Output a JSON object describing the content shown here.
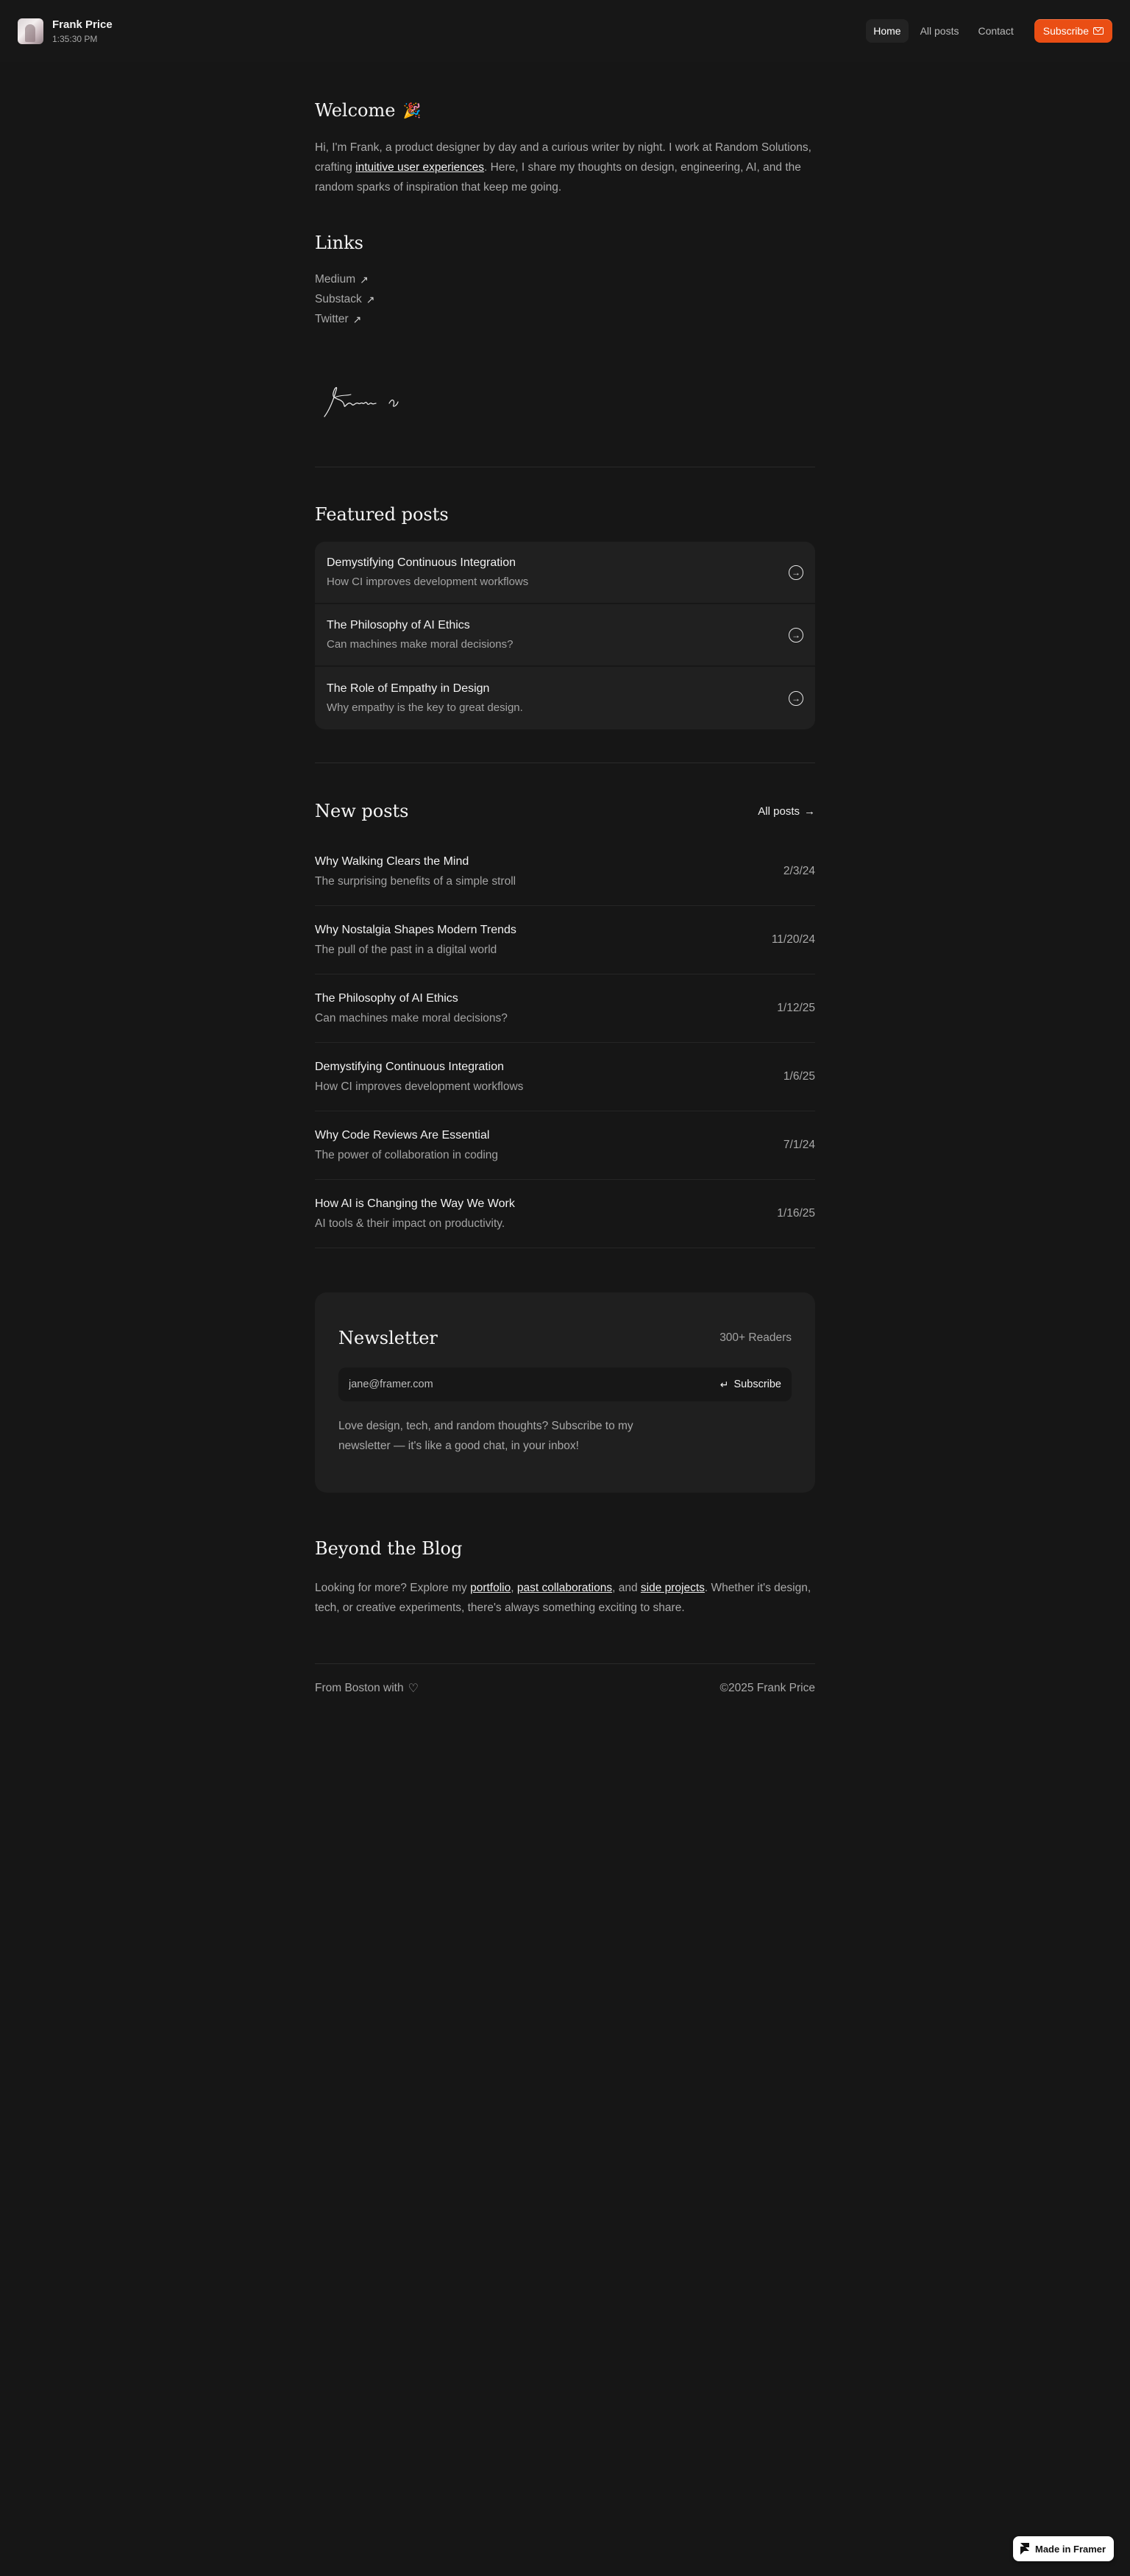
{
  "header": {
    "name": "Frank Price",
    "time": "1:35:30 PM",
    "nav": [
      {
        "label": "Home"
      },
      {
        "label": "All posts"
      },
      {
        "label": "Contact"
      }
    ],
    "subscribe_label": "Subscribe",
    "colors": {
      "accent": "#ea4e14"
    }
  },
  "welcome": {
    "title": "Welcome",
    "title_icon": "party-popper-icon",
    "text_before": "Hi, I'm Frank, a product designer by day and a curious writer by night. I work at Random Solutions, crafting ",
    "link": "intuitive user experiences",
    "text_after": ". Here, I share my thoughts on design, engineering, AI, and the random sparks of inspiration that keep me going."
  },
  "links": {
    "title": "Links",
    "items": [
      {
        "label": "Medium"
      },
      {
        "label": "Substack"
      },
      {
        "label": "Twitter"
      }
    ]
  },
  "featured": {
    "title": "Featured posts",
    "items": [
      {
        "title": "Demystifying Continuous Integration",
        "subtitle": "How CI improves development workflows"
      },
      {
        "title": "The Philosophy of AI Ethics",
        "subtitle": "Can machines make moral decisions?"
      },
      {
        "title": "The Role of Empathy in Design",
        "subtitle": "Why empathy is the key to great design."
      }
    ]
  },
  "new_posts": {
    "title": "New posts",
    "all_posts_label": "All posts",
    "items": [
      {
        "title": "Why Walking Clears the Mind",
        "subtitle": "The surprising benefits of a simple stroll",
        "date": "2/3/24"
      },
      {
        "title": "Why Nostalgia Shapes Modern Trends",
        "subtitle": "The pull of the past in a digital world",
        "date": "11/20/24"
      },
      {
        "title": "The Philosophy of AI Ethics",
        "subtitle": "Can machines make moral decisions?",
        "date": "1/12/25"
      },
      {
        "title": "Demystifying Continuous Integration",
        "subtitle": "How CI improves development workflows",
        "date": "1/6/25"
      },
      {
        "title": "Why Code Reviews Are Essential",
        "subtitle": "The power of collaboration in coding",
        "date": "7/1/24"
      },
      {
        "title": "How AI is Changing the Way We Work",
        "subtitle": "AI tools & their impact on productivity.",
        "date": "1/16/25"
      }
    ]
  },
  "newsletter": {
    "title": "Newsletter",
    "readers": "300+ Readers",
    "placeholder": "jane@framer.com",
    "submit_label": "Subscribe",
    "description": "Love design, tech, and random thoughts? Subscribe to my newsletter — it's like a good chat, in your inbox!"
  },
  "beyond": {
    "title": "Beyond the Blog",
    "text_1": "Looking for more? Explore my ",
    "link_1": "portfolio",
    "text_2": ", ",
    "link_2": "past collaborations",
    "text_3": ", and ",
    "link_3": "side projects",
    "text_4": ". Whether it's design, tech, or creative experiments, there's always something exciting to share."
  },
  "footer": {
    "left": "From Boston with",
    "right": "©2025 Frank Price"
  },
  "badge": {
    "label": "Made in Framer"
  }
}
